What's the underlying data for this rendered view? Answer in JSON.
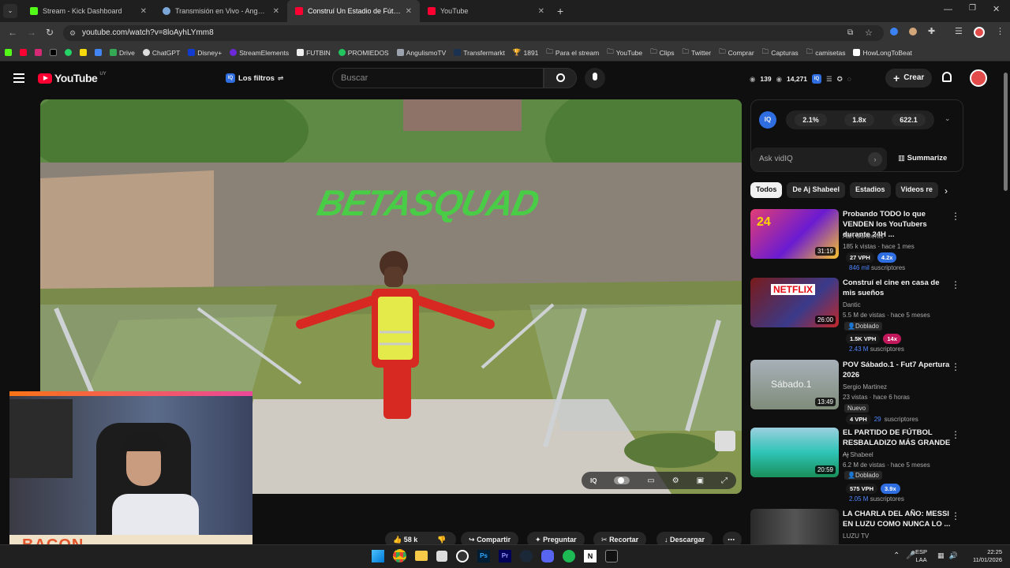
{
  "browser": {
    "tabs": [
      {
        "title": "Stream - Kick Dashboard",
        "fav_color": "#53fc18",
        "active": false
      },
      {
        "title": "Transmisión en Vivo - Angulismo",
        "fav_color": "#7aa7d8",
        "active": false
      },
      {
        "title": "Construí Un Estadio de Fútbol E",
        "fav_color": "#ff0033",
        "active": true
      },
      {
        "title": "YouTube",
        "fav_color": "#ff0033",
        "active": false
      }
    ],
    "new_tab": "+",
    "url": "youtube.com/watch?v=8loAyhLYmm8",
    "bookmarks": [
      "Drive",
      "ChatGPT",
      "Disney+",
      "StreamElements",
      "FUTBIN",
      "PROMIEDOS",
      "AngulismoTV",
      "Transfermarkt",
      "1891",
      "Para el stream",
      "YouTube",
      "Clips",
      "Twitter",
      "Comprar",
      "Capturas",
      "camisetas",
      "HowLongToBeat"
    ]
  },
  "youtube": {
    "logo_text": "YouTube",
    "country": "UY",
    "filter_label": "Los filtros",
    "search_placeholder": "Buscar",
    "stats_a": "139",
    "stats_b": "14,271",
    "create_label": "Crear"
  },
  "video": {
    "watermark": "BETASQUAD"
  },
  "vidiq": {
    "stat1": "2.1%",
    "stat2": "1.8x",
    "stat3": "622.1",
    "ask_placeholder": "Ask vidIQ",
    "summarize": "Summarize"
  },
  "chips": [
    "Todos",
    "De Aj Shabeel",
    "Estadios",
    "Videos re"
  ],
  "recommendations": [
    {
      "title": "Probando TODO lo que VENDEN los YouTubers durante 24H ...",
      "channel": "Adri Contreras",
      "meta": "185 k vistas · hace 1 mes",
      "duration": "31:19",
      "vph": "27 VPH",
      "mult": "4.2x",
      "subs_n": "846 mil",
      "subs": "suscriptores",
      "badge": ""
    },
    {
      "title": "Construí el cine en casa de mis sueños",
      "channel": "Dantic",
      "meta": "5.5 M de vistas · hace 5 meses",
      "duration": "26:00",
      "vph": "1.5K VPH",
      "mult": "14x",
      "subs_n": "2.43 M",
      "subs": "suscriptores",
      "badge": "Doblado"
    },
    {
      "title": "POV Sábado.1 - Fut7 Apertura 2026",
      "channel": "Sergio Martinez",
      "meta": "23 vistas · hace 6 horas",
      "duration": "13:49",
      "vph": "4 VPH",
      "mult": "",
      "subs_n": "29",
      "subs": "suscriptores",
      "badge": "Nuevo"
    },
    {
      "title": "EL PARTIDO DE FÚTBOL RESBALADIZO MÁS GRANDE ...",
      "channel": "Aj Shabeel",
      "meta": "6.2 M de vistas · hace 5 meses",
      "duration": "20:59",
      "vph": "575 VPH",
      "mult": "3.9x",
      "subs_n": "2.05 M",
      "subs": "suscriptores",
      "badge": "Doblado"
    },
    {
      "title": "LA CHARLA DEL AÑO: MESSI EN LUZU COMO NUNCA LO ...",
      "channel": "LUZU TV",
      "meta": "",
      "duration": "",
      "vph": "",
      "mult": "",
      "subs_n": "",
      "subs": "",
      "badge": ""
    }
  ],
  "actions": {
    "likes": "58 k",
    "share": "Compartir",
    "ask": "Preguntar",
    "clip": "Recortar",
    "download": "Descargar"
  },
  "webcam": {
    "overlay_text": "BACON"
  },
  "thumb_texts": {
    "t1_badge": "24",
    "t2_brand": "NETFLIX",
    "t3_label": "Sábado.1"
  },
  "taskbar": {
    "lang1": "ESP",
    "lang2": "LAA",
    "time": "22:25",
    "date": "11/01/2026"
  }
}
